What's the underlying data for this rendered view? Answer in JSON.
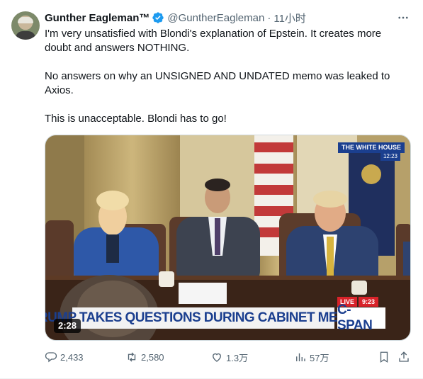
{
  "tweet": {
    "author": {
      "name": "Gunther Eagleman™",
      "handle": "@GuntherEagleman",
      "separator": "·",
      "time": "11小时"
    },
    "paragraphs": [
      "I'm very unsatisfied with Blondi's explanation of Epstein. It creates more doubt and answers NOTHING.",
      "No answers on why an UNSIGNED AND UNDATED memo was leaked to Axios.",
      "This is unacceptable. Blondi has to go!"
    ],
    "media": {
      "duration": "2:28",
      "chyron": "TRUMP TAKES QUESTIONS DURING CABINET MEETING",
      "network": "C-SPAN",
      "live_label": "LIVE",
      "live_time": "9:23",
      "location_badge": "THE WHITE HOUSE",
      "location_time": "12:23"
    },
    "actions": {
      "replies": "2,433",
      "reposts": "2,580",
      "likes": "1.3万",
      "views": "57万"
    }
  },
  "colors": {
    "text": "#0f1419",
    "secondary": "#536471",
    "verified": "#1d9bf0",
    "chyron_text": "#1b3f8f",
    "live_red": "#d8232a"
  }
}
